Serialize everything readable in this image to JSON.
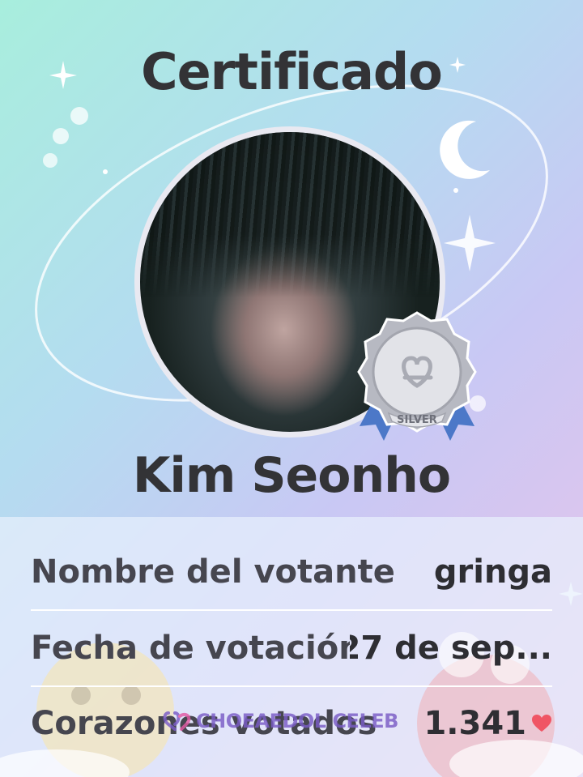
{
  "certificate": {
    "title": "Certificado",
    "name": "Kim Seonho",
    "badge": {
      "tier": "SILVER",
      "icon": "heart-logo-icon"
    }
  },
  "details": {
    "rows": [
      {
        "label": "Nombre del votante",
        "value": "gringa"
      },
      {
        "label": "Fecha de votación",
        "value": "27 de sep..."
      },
      {
        "label": "Corazones votados",
        "value": "1.341",
        "icon": "heart-icon"
      }
    ]
  },
  "watermark": {
    "text": "CHOEAEDOL CELEB",
    "icon": "choeaedol-logo-icon"
  },
  "colors": {
    "text_dark": "#333336",
    "heart": "#f05564",
    "badge_silver": "#c9cbd3",
    "ribbon": "#4c78c8",
    "watermark": "#7a5cc6"
  }
}
